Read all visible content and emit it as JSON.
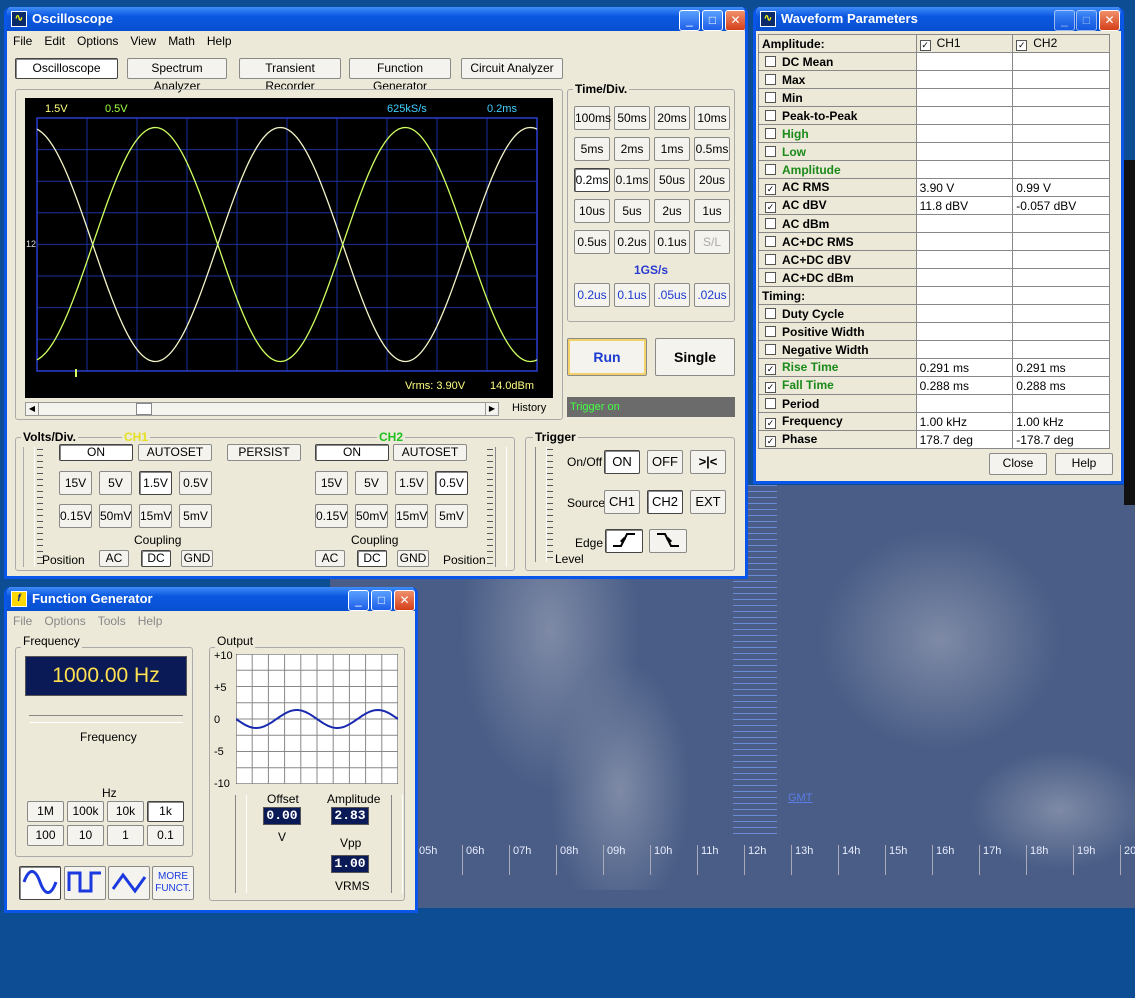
{
  "desktop": {
    "gmt_label": "GMT",
    "hours": [
      "05h",
      "06h",
      "07h",
      "08h",
      "09h",
      "10h",
      "11h",
      "12h",
      "13h",
      "14h",
      "15h",
      "16h",
      "17h",
      "18h",
      "19h",
      "20"
    ]
  },
  "osc": {
    "title": "Oscilloscope",
    "menu": [
      "File",
      "Edit",
      "Options",
      "View",
      "Math",
      "Help"
    ],
    "tabs": [
      "Oscilloscope",
      "Spectrum Analyzer",
      "Transient Recorder",
      "Function Generator",
      "Circuit Analyzer"
    ],
    "screen": {
      "ch1_scale": "1.5V",
      "ch2_scale": "0.5V",
      "sample_rate": "625kS/s",
      "time_div": "0.2ms",
      "vrms": "Vrms: 3.90V",
      "dbm": "14.0dBm",
      "pos_marker": "12"
    },
    "scroll": {
      "history": "History"
    },
    "timediv": {
      "title": "Time/Div.",
      "buttons": [
        "100ms",
        "50ms",
        "20ms",
        "10ms",
        "5ms",
        "2ms",
        "1ms",
        "0.5ms",
        "0.2ms",
        "0.1ms",
        "50us",
        "20us",
        "10us",
        "5us",
        "2us",
        "1us",
        "0.5us",
        "0.2us",
        "0.1us",
        "S/L"
      ],
      "fast_label": "1GS/s",
      "fast": [
        "0.2us",
        "0.1us",
        ".05us",
        ".02us"
      ],
      "selected": "0.2ms"
    },
    "run": "Run",
    "single": "Single",
    "trigger_status": "Trigger on",
    "volts": {
      "title": "Volts/Div.",
      "ch1": "CH1",
      "ch2": "CH2",
      "on": "ON",
      "autoset": "AUTOSET",
      "persist": "PERSIST",
      "ranges": [
        "15V",
        "5V",
        "1.5V",
        "0.5V",
        "0.15V",
        "50mV",
        "15mV",
        "5mV"
      ],
      "coupling": "Coupling",
      "ac": "AC",
      "dc": "DC",
      "gnd": "GND",
      "position": "Position",
      "ch1_selected": "1.5V",
      "ch2_selected": "0.5V"
    },
    "trigger": {
      "title": "Trigger",
      "onoff": "On/Off",
      "on": "ON",
      "off": "OFF",
      "center": ">|<",
      "source": "Source",
      "ch1": "CH1",
      "ch2": "CH2",
      "ext": "EXT",
      "edge": "Edge",
      "level": "Level"
    }
  },
  "wp": {
    "title": "Waveform Parameters",
    "amplitude_header": "Amplitude:",
    "ch1": "CH1",
    "ch2": "CH2",
    "timing_header": "Timing:",
    "amp_rows": [
      {
        "label": "DC  Mean",
        "checked": false,
        "green": false,
        "ch1": "",
        "ch2": ""
      },
      {
        "label": "Max",
        "checked": false,
        "green": false,
        "ch1": "",
        "ch2": ""
      },
      {
        "label": "Min",
        "checked": false,
        "green": false,
        "ch1": "",
        "ch2": ""
      },
      {
        "label": "Peak-to-Peak",
        "checked": false,
        "green": false,
        "ch1": "",
        "ch2": ""
      },
      {
        "label": "High",
        "checked": false,
        "green": true,
        "ch1": "",
        "ch2": ""
      },
      {
        "label": "Low",
        "checked": false,
        "green": true,
        "ch1": "",
        "ch2": ""
      },
      {
        "label": "Amplitude",
        "checked": false,
        "green": true,
        "ch1": "",
        "ch2": ""
      },
      {
        "label": "AC RMS",
        "checked": true,
        "green": false,
        "ch1": "3.90 V",
        "ch2": "0.99 V"
      },
      {
        "label": "AC dBV",
        "checked": true,
        "green": false,
        "ch1": "11.8 dBV",
        "ch2": "-0.057 dBV"
      },
      {
        "label": "AC dBm",
        "checked": false,
        "green": false,
        "ch1": "",
        "ch2": ""
      },
      {
        "label": "AC+DC RMS",
        "checked": false,
        "green": false,
        "ch1": "",
        "ch2": ""
      },
      {
        "label": "AC+DC dBV",
        "checked": false,
        "green": false,
        "ch1": "",
        "ch2": ""
      },
      {
        "label": "AC+DC dBm",
        "checked": false,
        "green": false,
        "ch1": "",
        "ch2": ""
      }
    ],
    "time_rows": [
      {
        "label": "Duty Cycle",
        "checked": false,
        "green": false,
        "ch1": "",
        "ch2": ""
      },
      {
        "label": "Positive Width",
        "checked": false,
        "green": false,
        "ch1": "",
        "ch2": ""
      },
      {
        "label": "Negative Width",
        "checked": false,
        "green": false,
        "ch1": "",
        "ch2": ""
      },
      {
        "label": "Rise Time",
        "checked": true,
        "green": true,
        "ch1": "0.291 ms",
        "ch2": "0.291 ms"
      },
      {
        "label": "Fall Time",
        "checked": true,
        "green": true,
        "ch1": "0.288 ms",
        "ch2": "0.288 ms"
      },
      {
        "label": "Period",
        "checked": false,
        "green": false,
        "ch1": "",
        "ch2": ""
      },
      {
        "label": "Frequency",
        "checked": true,
        "green": false,
        "ch1": "1.00 kHz",
        "ch2": "1.00 kHz"
      },
      {
        "label": "Phase",
        "checked": true,
        "green": false,
        "ch1": "178.7 deg",
        "ch2": "-178.7 deg"
      }
    ],
    "close": "Close",
    "help": "Help"
  },
  "fg": {
    "title": "Function Generator",
    "menu": [
      "File",
      "Options",
      "Tools",
      "Help"
    ],
    "freq_group": "Frequency",
    "freq_display": "1000.00 Hz",
    "freq_slider_label": "Frequency",
    "hz": "Hz",
    "ranges": [
      "1M",
      "100k",
      "10k",
      "1k",
      "100",
      "10",
      "1",
      "0.1"
    ],
    "range_selected": "1k",
    "more": "MORE\nFUNCT.",
    "output_group": "Output",
    "yticks": [
      "+10",
      "+5",
      "0",
      "-5",
      "-10"
    ],
    "offset_label": "Offset",
    "offset": "0.00",
    "offset_unit": "V",
    "amplitude_label": "Amplitude",
    "amplitude": "2.83",
    "amplitude_unit": "Vpp",
    "vrms": "1.00",
    "vrms_unit": "VRMS"
  }
}
